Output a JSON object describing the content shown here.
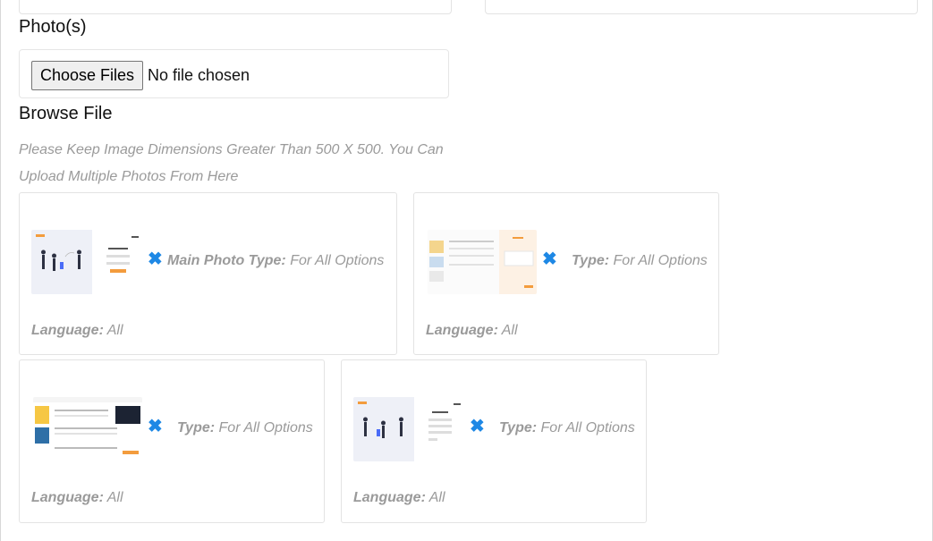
{
  "form": {
    "photos_label": "Photo(s)",
    "choose_button": "Choose Files",
    "no_file_text": "No file chosen",
    "browse_label": "Browse File",
    "hint": "Please Keep Image Dimensions Greater Than 500 X 500. You Can Upload Multiple Photos From Here"
  },
  "cards": [
    {
      "main_label": "Main Photo",
      "type_label": "Type:",
      "type_value": "For All Options",
      "language_label": "Language:",
      "language_value": "All",
      "remove_icon": "close-x-icon",
      "thumbnail": "sign-in-screen"
    },
    {
      "type_label": "Type:",
      "type_value": "For All Options",
      "language_label": "Language:",
      "language_value": "All",
      "remove_icon": "close-x-icon",
      "thumbnail": "checkout-screen"
    },
    {
      "type_label": "Type:",
      "type_value": "For All Options",
      "language_label": "Language:",
      "language_value": "All",
      "remove_icon": "close-x-icon",
      "thumbnail": "dashboard-screen"
    },
    {
      "type_label": "Type:",
      "type_value": "For All Options",
      "language_label": "Language:",
      "language_value": "All",
      "remove_icon": "close-x-icon",
      "thumbnail": "register-screen"
    }
  ],
  "colors": {
    "accent": "#1e88e5",
    "muted_text": "#9a9a9a",
    "border": "#e3e3e3"
  }
}
